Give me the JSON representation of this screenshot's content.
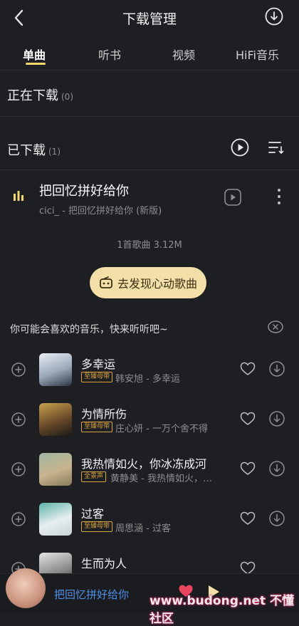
{
  "header": {
    "title": "下载管理"
  },
  "tabs": [
    {
      "label": "单曲",
      "active": true
    },
    {
      "label": "听书"
    },
    {
      "label": "视频"
    },
    {
      "label": "HiFi音乐"
    }
  ],
  "downloading": {
    "label": "正在下载",
    "count": "(0)"
  },
  "downloaded": {
    "label": "已下载",
    "count": "(1)",
    "item": {
      "title": "把回忆拼好给你",
      "subtitle": "cici_ - 把回忆拼好给你 (新版)"
    },
    "summary": "1首歌曲  3.12M"
  },
  "discover_button": "去发现心动歌曲",
  "recommend_header": "你可能会喜欢的音乐，快来听听吧~",
  "recommend": [
    {
      "title": "多幸运",
      "badge": "至臻母带",
      "subtitle": "韩安旭 - 多幸运"
    },
    {
      "title": "为情所伤",
      "badge": "至臻母带",
      "subtitle": "庄心妍 - 一万个舍不得"
    },
    {
      "title": "我热情如火，你冰冻成河",
      "badge": "全景声",
      "subtitle": "黄静美 - 我热情如火，…"
    },
    {
      "title": "过客",
      "badge": "至臻母带",
      "subtitle": "周思涵 - 过客"
    },
    {
      "title": "生而为人",
      "badge": "",
      "subtitle": ""
    }
  ],
  "mini_player": {
    "title": "把回忆拼好给你"
  },
  "watermark": "www.budong.net 不懂社区",
  "colors": {
    "accent": "#f5d76e",
    "background": "#1d1f23",
    "badge": "#d7a33b"
  }
}
